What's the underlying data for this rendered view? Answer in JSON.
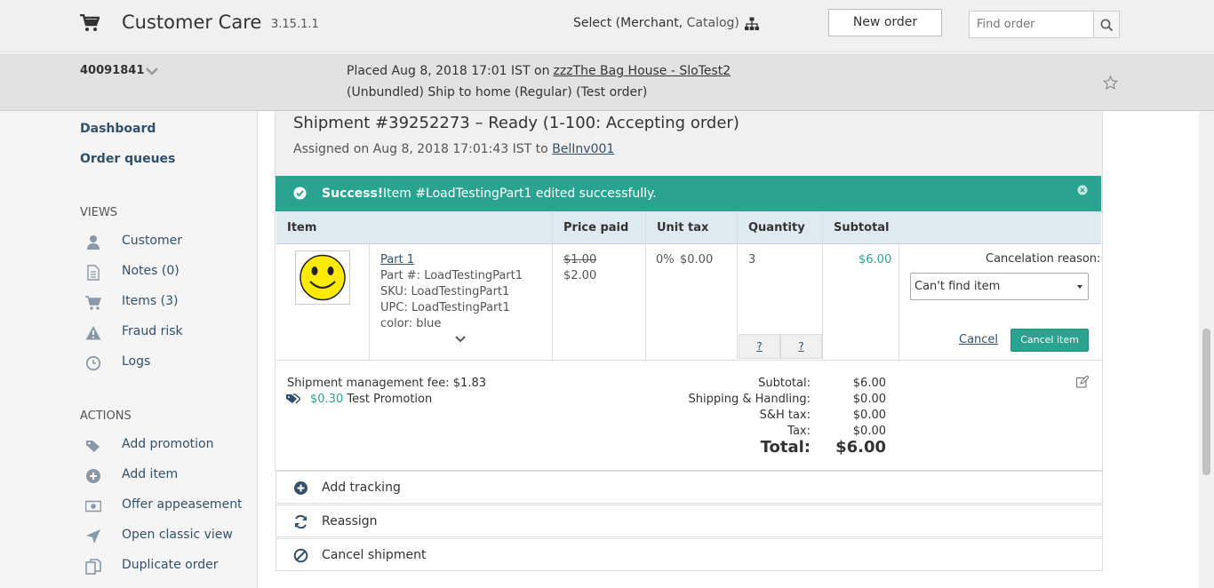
{
  "header": {
    "app_title": "Customer Care",
    "version": "3.15.1.1",
    "select_prefix": "Select (Merchant, ",
    "select_catalog": "Catalog)",
    "new_order_label": "New order",
    "find_order_placeholder": "Find order"
  },
  "order": {
    "number": "40091841",
    "placed_text": "Placed Aug 8, 2018 17:01 IST on",
    "store_link": "zzzThe Bag House - SloTest2",
    "details": "(Unbundled)  Ship to home (Regular) (Test order)"
  },
  "sidebar": {
    "links": [
      "Dashboard",
      "Order queues"
    ],
    "views_heading": "VIEWS",
    "views": [
      {
        "label": "Customer",
        "icon": "user-icon"
      },
      {
        "label": "Notes (0)",
        "icon": "notes-icon"
      },
      {
        "label": "Items (3)",
        "icon": "cart-icon"
      },
      {
        "label": "Fraud risk",
        "icon": "warning-icon"
      },
      {
        "label": "Logs",
        "icon": "clock-icon"
      }
    ],
    "actions_heading": "ACTIONS",
    "actions": [
      {
        "label": "Add promotion",
        "icon": "tags-icon"
      },
      {
        "label": "Add item",
        "icon": "plus-circle-icon"
      },
      {
        "label": "Offer appeasement",
        "icon": "money-icon"
      },
      {
        "label": "Open classic view",
        "icon": "location-arrow-icon"
      },
      {
        "label": "Duplicate order",
        "icon": "copy-icon"
      }
    ]
  },
  "shipment": {
    "title": "Shipment #39252273 – Ready (1-100: Accepting order)",
    "assigned_prefix": "Assigned on Aug 8, 2018 17:01:43 IST to ",
    "assigned_to": "BelInv001",
    "success_bold": "Success!",
    "success_msg": "Item #LoadTestingPart1 edited successfully.",
    "columns": [
      "Item",
      "Price paid",
      "Unit tax",
      "Quantity",
      "Subtotal"
    ],
    "item": {
      "name": "Part 1",
      "part_no": "Part #: LoadTestingPart1",
      "sku": "SKU: LoadTestingPart1",
      "upc": "UPC: LoadTestingPart1",
      "color": "color: blue",
      "price_original": "$1.00",
      "price_paid": "$2.00",
      "tax_rate": "0%",
      "tax_amount": "$0.00",
      "quantity": "3",
      "qty_btn_1": "?",
      "qty_btn_2": "?",
      "subtotal": "$6.00"
    },
    "cancel": {
      "reason_label": "Cancelation reason:",
      "reason_value": "Can't find item",
      "cancel_link": "Cancel",
      "cancel_item_btn": "Cancel item"
    },
    "fee": "Shipment management fee: $1.83",
    "promo_amount": "$0.30",
    "promo_name": "Test Promotion",
    "totals": {
      "subtotal_label": "Subtotal:",
      "subtotal": "$6.00",
      "shipping_label": "Shipping & Handling:",
      "shipping": "$0.00",
      "sh_tax_label": "S&H tax:",
      "sh_tax": "$0.00",
      "tax_label": "Tax:",
      "tax": "$0.00",
      "total_label": "Total:",
      "total": "$6.00"
    }
  },
  "actions_rows": [
    {
      "label": "Add tracking",
      "icon": "plus-circle-icon"
    },
    {
      "label": "Reassign",
      "icon": "refresh-icon"
    },
    {
      "label": "Cancel shipment",
      "icon": "ban-icon"
    }
  ],
  "colors": {
    "accent": "#2ba391",
    "link": "#33506b"
  }
}
